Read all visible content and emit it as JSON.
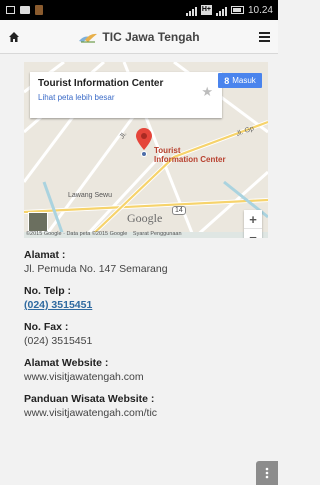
{
  "status_bar": {
    "network": "H+",
    "time": "10.24"
  },
  "header": {
    "title": "TIC Jawa Tengah",
    "home_icon": "home-icon",
    "menu_icon": "menu-icon"
  },
  "map": {
    "info_title": "Tourist Information Center",
    "info_link": "Lihat peta lebih besar",
    "sign_in_label": "Masuk",
    "poi_label_line1": "Tourist",
    "poi_label_line2": "Information Center",
    "place_label": "Lawang Sewu",
    "street_jl": "Jl.",
    "street_jl_gp": "Jl. Gp",
    "route_number": "14",
    "google_logo": "Google",
    "copyright": "©2015 Google · Data peta ©2015 Google",
    "terms": "Syarat Penggunaan",
    "zoom_in": "+",
    "zoom_out": "−",
    "colors": {
      "water": "#aad3df",
      "road_major": "#f6d36c",
      "pin": "#e5453a",
      "signin": "#4a84ed"
    }
  },
  "details": {
    "address_label": "Alamat :",
    "address_value": "Jl. Pemuda No. 147 Semarang",
    "phone_label": "No. Telp :",
    "phone_value": "(024) 3515451",
    "fax_label": "No. Fax :",
    "fax_value": "(024) 3515451",
    "website_label": "Alamat Website :",
    "website_value": "www.visitjawatengah.com",
    "guide_label": "Panduan Wisata Website :",
    "guide_value": "www.visitjawatengah.com/tic"
  }
}
